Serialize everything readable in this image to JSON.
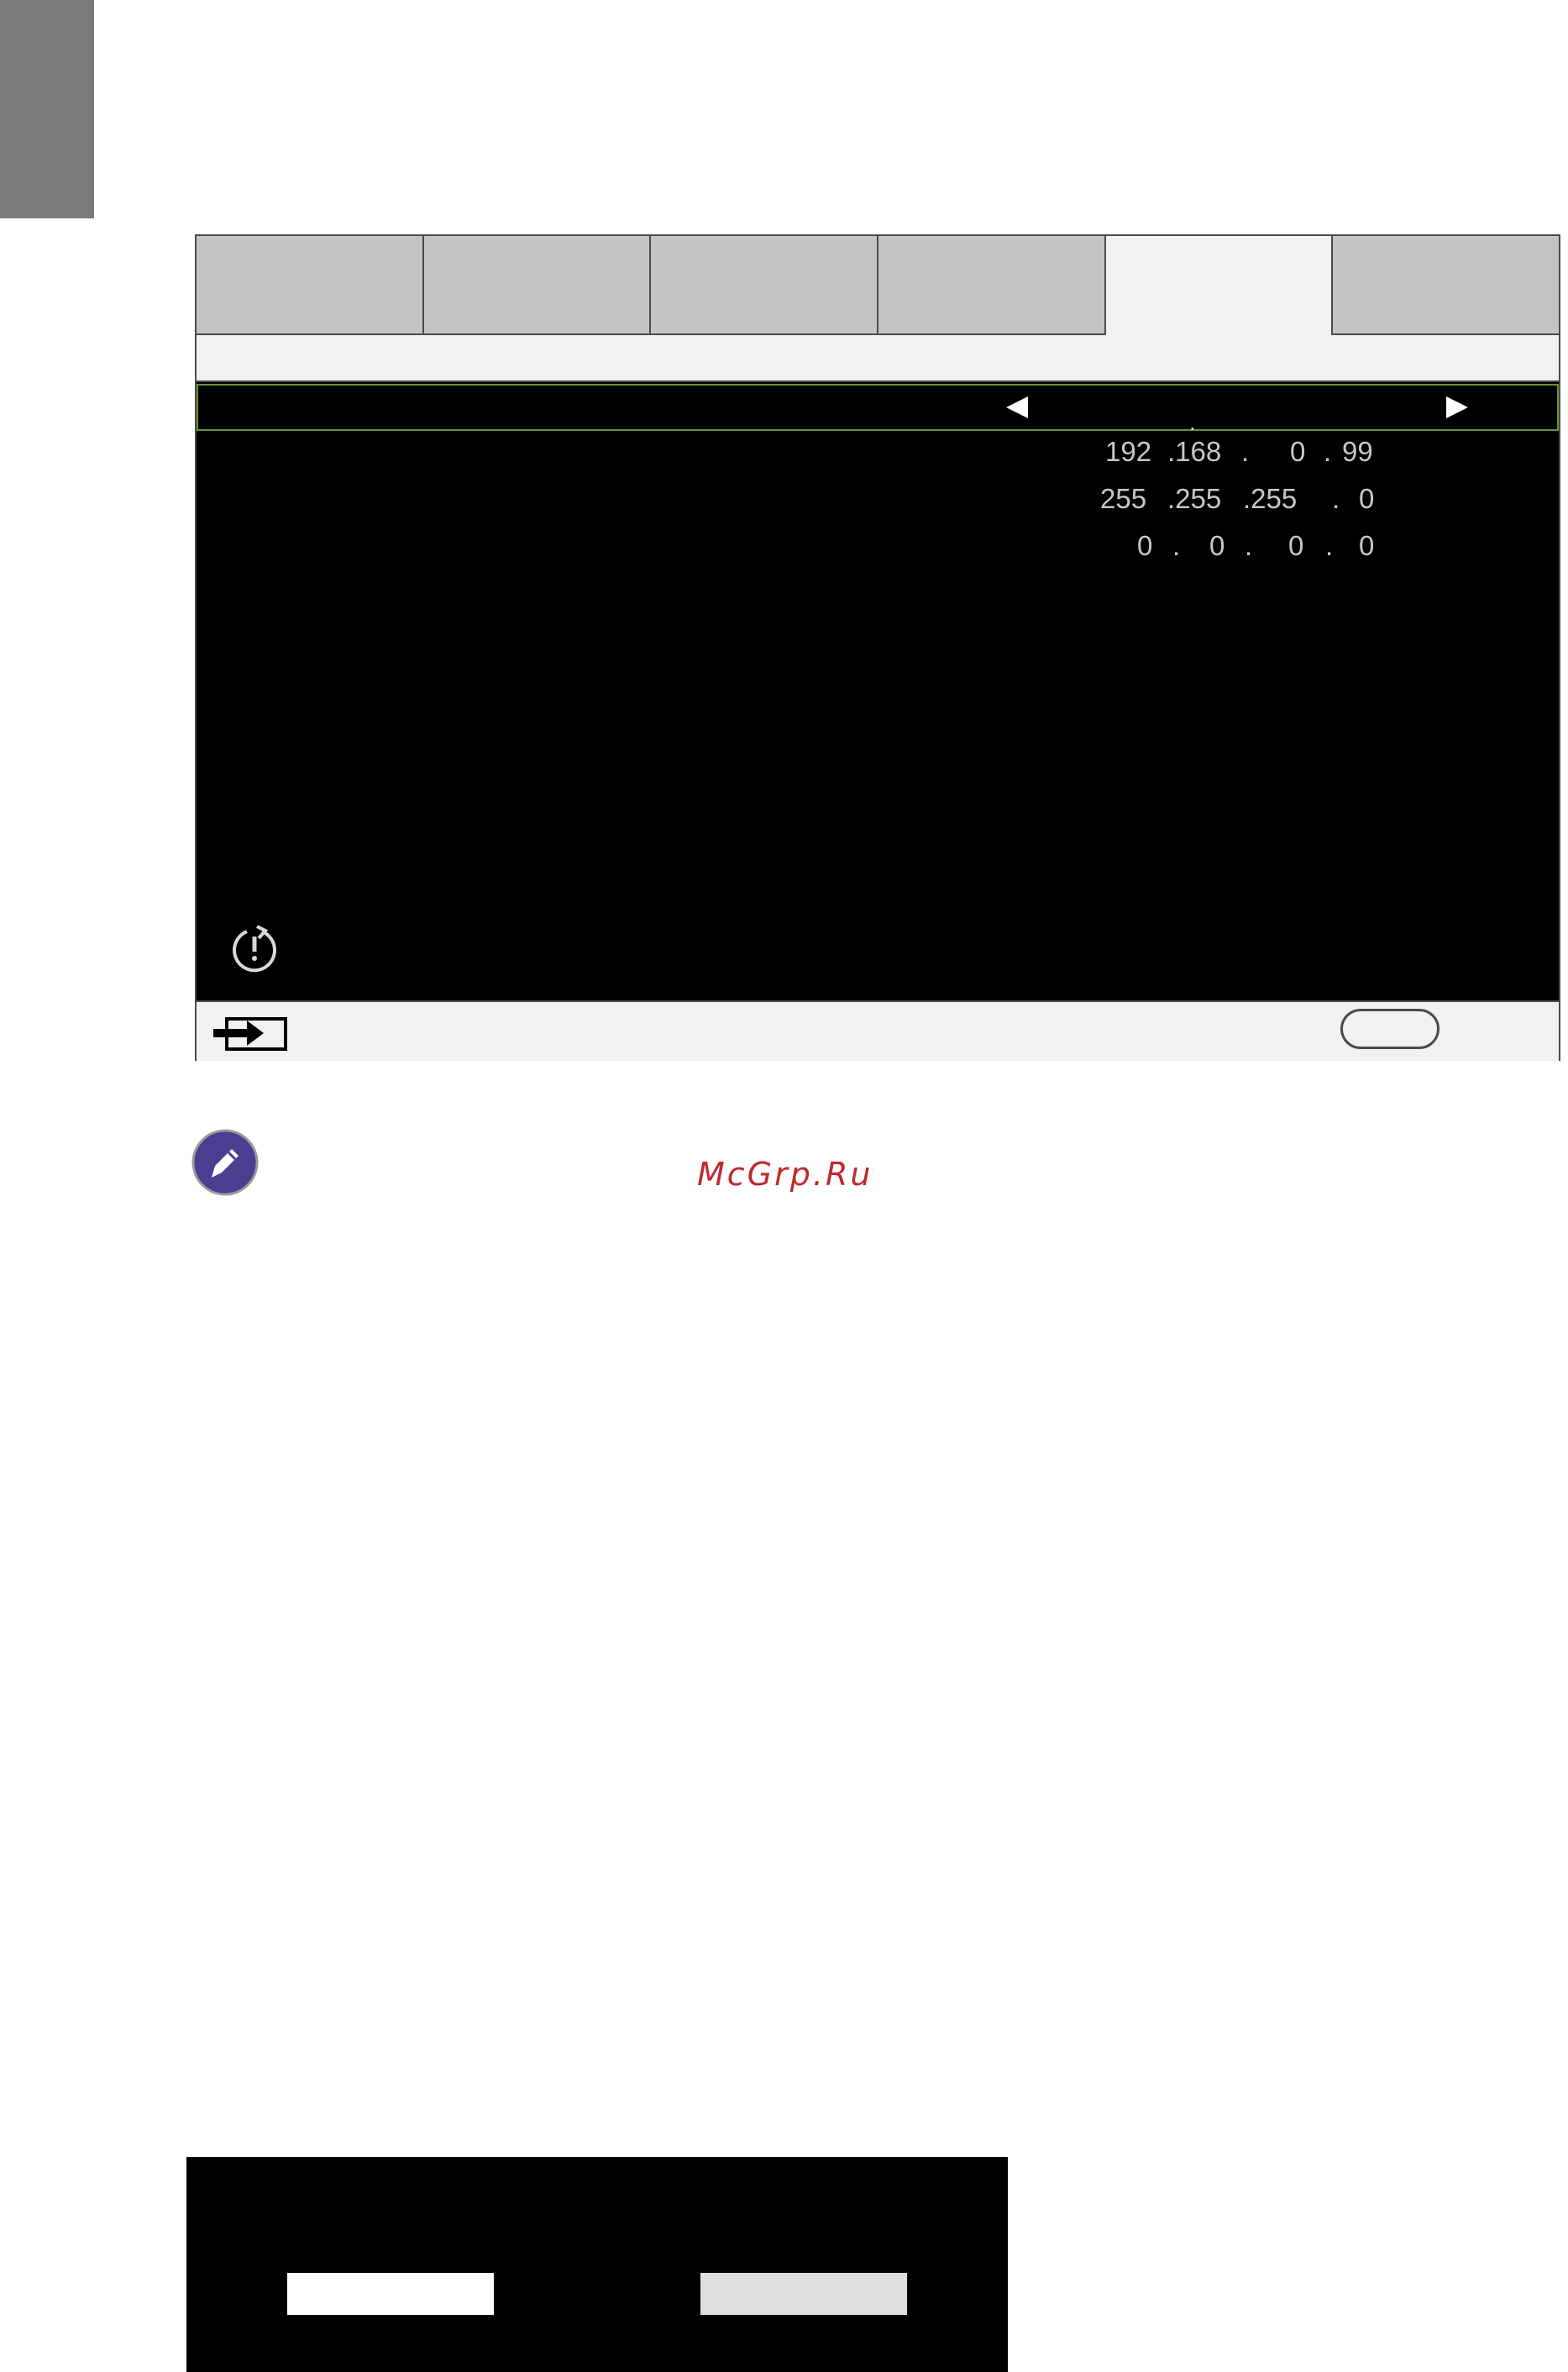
{
  "osd": {
    "tabs": [
      "",
      "",
      "",
      "",
      "",
      ""
    ],
    "active_tab_index": 4,
    "selected_row": {
      "value": "."
    },
    "ip_rows": [
      {
        "name": "ip-address",
        "segments": [
          "192",
          ".168",
          ".",
          "0",
          ".",
          "99"
        ]
      },
      {
        "name": "subnet-mask",
        "segments": [
          "255",
          ".255",
          ".255",
          ".",
          "0"
        ]
      },
      {
        "name": "default-gateway",
        "segments": [
          "0",
          ".",
          "0",
          ".",
          "0",
          ".",
          "0"
        ]
      }
    ],
    "icons": {
      "left_arrow": "left-arrow-icon",
      "right_arrow": "right-arrow-icon",
      "power": "power-icon",
      "source": "source-input-icon"
    },
    "colors": {
      "tab_inactive": "#c4c4c4",
      "tab_active": "#f1f1f1",
      "selection_border": "#6b8f3a",
      "menu_background": "#000000"
    }
  },
  "note": {
    "icon": "pencil-note-icon",
    "color": "#4b3d8f"
  },
  "watermark": {
    "text": "McGrp.Ru",
    "color": "#c0292b"
  },
  "dialog": {
    "yes_label": "",
    "no_label": ""
  }
}
